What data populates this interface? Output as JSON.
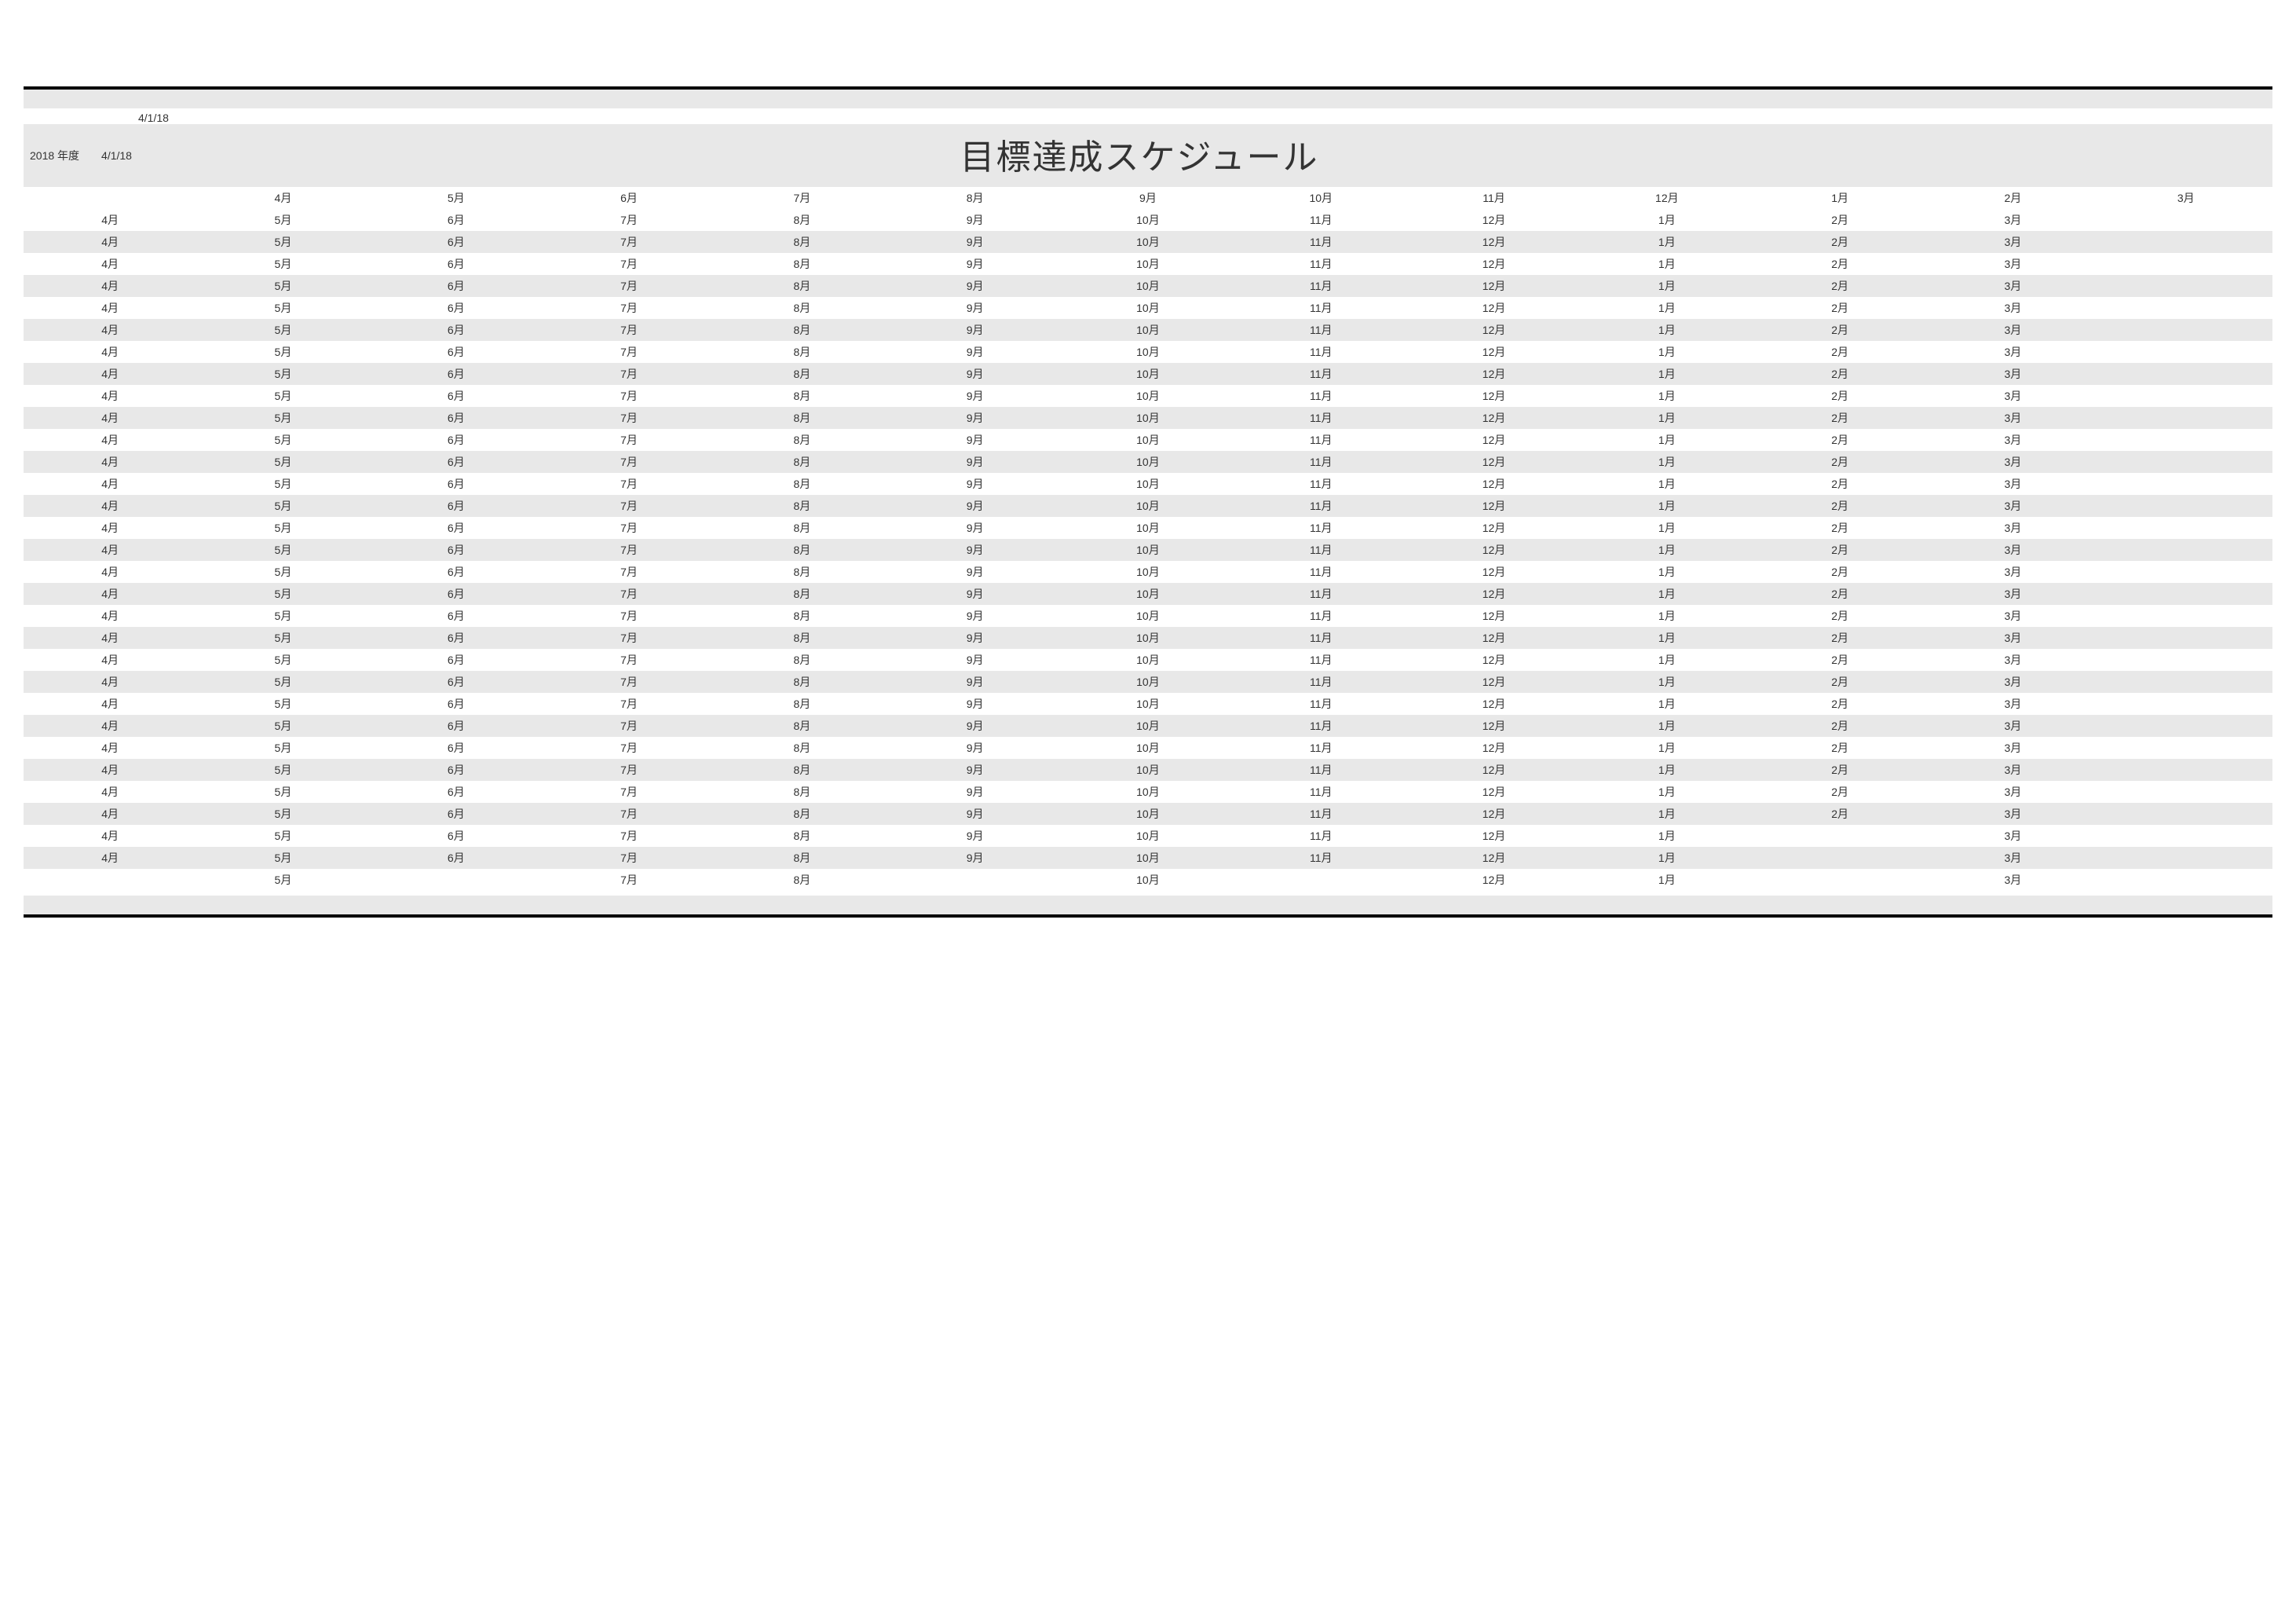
{
  "meta": {
    "date_a": "4/1/18",
    "year_label": "2018 年度",
    "date_b": "4/1/18"
  },
  "title": "目標達成スケジュール",
  "header_cols": [
    "",
    "4月",
    "5月",
    "6月",
    "7月",
    "8月",
    "9月",
    "10月",
    "11月",
    "12月",
    "1月",
    "2月",
    "3月"
  ],
  "rows": [
    [
      "4月",
      "5月",
      "6月",
      "7月",
      "8月",
      "9月",
      "10月",
      "11月",
      "12月",
      "1月",
      "2月",
      "3月",
      ""
    ],
    [
      "4月",
      "5月",
      "6月",
      "7月",
      "8月",
      "9月",
      "10月",
      "11月",
      "12月",
      "1月",
      "2月",
      "3月",
      ""
    ],
    [
      "4月",
      "5月",
      "6月",
      "7月",
      "8月",
      "9月",
      "10月",
      "11月",
      "12月",
      "1月",
      "2月",
      "3月",
      ""
    ],
    [
      "4月",
      "5月",
      "6月",
      "7月",
      "8月",
      "9月",
      "10月",
      "11月",
      "12月",
      "1月",
      "2月",
      "3月",
      ""
    ],
    [
      "4月",
      "5月",
      "6月",
      "7月",
      "8月",
      "9月",
      "10月",
      "11月",
      "12月",
      "1月",
      "2月",
      "3月",
      ""
    ],
    [
      "4月",
      "5月",
      "6月",
      "7月",
      "8月",
      "9月",
      "10月",
      "11月",
      "12月",
      "1月",
      "2月",
      "3月",
      ""
    ],
    [
      "4月",
      "5月",
      "6月",
      "7月",
      "8月",
      "9月",
      "10月",
      "11月",
      "12月",
      "1月",
      "2月",
      "3月",
      ""
    ],
    [
      "4月",
      "5月",
      "6月",
      "7月",
      "8月",
      "9月",
      "10月",
      "11月",
      "12月",
      "1月",
      "2月",
      "3月",
      ""
    ],
    [
      "4月",
      "5月",
      "6月",
      "7月",
      "8月",
      "9月",
      "10月",
      "11月",
      "12月",
      "1月",
      "2月",
      "3月",
      ""
    ],
    [
      "4月",
      "5月",
      "6月",
      "7月",
      "8月",
      "9月",
      "10月",
      "11月",
      "12月",
      "1月",
      "2月",
      "3月",
      ""
    ],
    [
      "4月",
      "5月",
      "6月",
      "7月",
      "8月",
      "9月",
      "10月",
      "11月",
      "12月",
      "1月",
      "2月",
      "3月",
      ""
    ],
    [
      "4月",
      "5月",
      "6月",
      "7月",
      "8月",
      "9月",
      "10月",
      "11月",
      "12月",
      "1月",
      "2月",
      "3月",
      ""
    ],
    [
      "4月",
      "5月",
      "6月",
      "7月",
      "8月",
      "9月",
      "10月",
      "11月",
      "12月",
      "1月",
      "2月",
      "3月",
      ""
    ],
    [
      "4月",
      "5月",
      "6月",
      "7月",
      "8月",
      "9月",
      "10月",
      "11月",
      "12月",
      "1月",
      "2月",
      "3月",
      ""
    ],
    [
      "4月",
      "5月",
      "6月",
      "7月",
      "8月",
      "9月",
      "10月",
      "11月",
      "12月",
      "1月",
      "2月",
      "3月",
      ""
    ],
    [
      "4月",
      "5月",
      "6月",
      "7月",
      "8月",
      "9月",
      "10月",
      "11月",
      "12月",
      "1月",
      "2月",
      "3月",
      ""
    ],
    [
      "4月",
      "5月",
      "6月",
      "7月",
      "8月",
      "9月",
      "10月",
      "11月",
      "12月",
      "1月",
      "2月",
      "3月",
      ""
    ],
    [
      "4月",
      "5月",
      "6月",
      "7月",
      "8月",
      "9月",
      "10月",
      "11月",
      "12月",
      "1月",
      "2月",
      "3月",
      ""
    ],
    [
      "4月",
      "5月",
      "6月",
      "7月",
      "8月",
      "9月",
      "10月",
      "11月",
      "12月",
      "1月",
      "2月",
      "3月",
      ""
    ],
    [
      "4月",
      "5月",
      "6月",
      "7月",
      "8月",
      "9月",
      "10月",
      "11月",
      "12月",
      "1月",
      "2月",
      "3月",
      ""
    ],
    [
      "4月",
      "5月",
      "6月",
      "7月",
      "8月",
      "9月",
      "10月",
      "11月",
      "12月",
      "1月",
      "2月",
      "3月",
      ""
    ],
    [
      "4月",
      "5月",
      "6月",
      "7月",
      "8月",
      "9月",
      "10月",
      "11月",
      "12月",
      "1月",
      "2月",
      "3月",
      ""
    ],
    [
      "4月",
      "5月",
      "6月",
      "7月",
      "8月",
      "9月",
      "10月",
      "11月",
      "12月",
      "1月",
      "2月",
      "3月",
      ""
    ],
    [
      "4月",
      "5月",
      "6月",
      "7月",
      "8月",
      "9月",
      "10月",
      "11月",
      "12月",
      "1月",
      "2月",
      "3月",
      ""
    ],
    [
      "4月",
      "5月",
      "6月",
      "7月",
      "8月",
      "9月",
      "10月",
      "11月",
      "12月",
      "1月",
      "2月",
      "3月",
      ""
    ],
    [
      "4月",
      "5月",
      "6月",
      "7月",
      "8月",
      "9月",
      "10月",
      "11月",
      "12月",
      "1月",
      "2月",
      "3月",
      ""
    ],
    [
      "4月",
      "5月",
      "6月",
      "7月",
      "8月",
      "9月",
      "10月",
      "11月",
      "12月",
      "1月",
      "2月",
      "3月",
      ""
    ],
    [
      "4月",
      "5月",
      "6月",
      "7月",
      "8月",
      "9月",
      "10月",
      "11月",
      "12月",
      "1月",
      "2月",
      "3月",
      ""
    ],
    [
      "4月",
      "5月",
      "6月",
      "7月",
      "8月",
      "9月",
      "10月",
      "11月",
      "12月",
      "1月",
      "",
      "3月",
      ""
    ],
    [
      "4月",
      "5月",
      "6月",
      "7月",
      "8月",
      "9月",
      "10月",
      "11月",
      "12月",
      "1月",
      "",
      "3月",
      ""
    ],
    [
      "",
      "5月",
      "",
      "7月",
      "8月",
      "",
      "10月",
      "",
      "12月",
      "1月",
      "",
      "3月",
      ""
    ]
  ]
}
